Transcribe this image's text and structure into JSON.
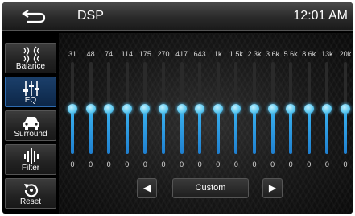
{
  "header": {
    "title": "DSP",
    "time": "12:01 AM",
    "back_icon": "back-arrow-icon"
  },
  "sidebar": {
    "items": [
      {
        "label": "Balance",
        "icon": "balance-speaker-icon",
        "active": false
      },
      {
        "label": "EQ",
        "icon": "eq-sliders-icon",
        "active": true
      },
      {
        "label": "Surround",
        "icon": "car-icon",
        "active": false
      },
      {
        "label": "Filter",
        "icon": "filter-bars-icon",
        "active": false
      },
      {
        "label": "Reset",
        "icon": "reset-icon",
        "active": false
      }
    ]
  },
  "eq": {
    "bands": [
      {
        "freq": "31",
        "gain": "0"
      },
      {
        "freq": "48",
        "gain": "0"
      },
      {
        "freq": "74",
        "gain": "0"
      },
      {
        "freq": "114",
        "gain": "0"
      },
      {
        "freq": "175",
        "gain": "0"
      },
      {
        "freq": "270",
        "gain": "0"
      },
      {
        "freq": "417",
        "gain": "0"
      },
      {
        "freq": "643",
        "gain": "0"
      },
      {
        "freq": "1k",
        "gain": "0"
      },
      {
        "freq": "1.5k",
        "gain": "0"
      },
      {
        "freq": "2.3k",
        "gain": "0"
      },
      {
        "freq": "3.6k",
        "gain": "0"
      },
      {
        "freq": "5.6k",
        "gain": "0"
      },
      {
        "freq": "8.6k",
        "gain": "0"
      },
      {
        "freq": "13k",
        "gain": "0"
      },
      {
        "freq": "20k",
        "gain": "0"
      }
    ],
    "preset": "Custom",
    "prev_icon": "triangle-left-icon",
    "next_icon": "triangle-right-icon"
  },
  "colors": {
    "accent": "#3bb4f0",
    "active_tab": "#1b3f6a"
  }
}
